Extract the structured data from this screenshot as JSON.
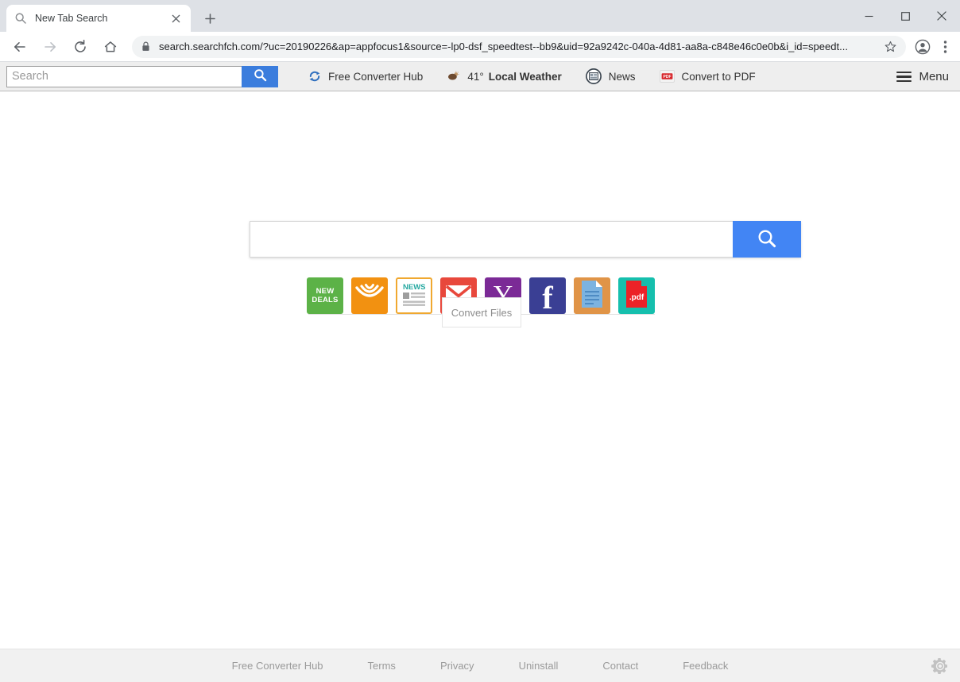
{
  "browser": {
    "tab": {
      "title": "New Tab Search",
      "favicon": "search-icon",
      "close": "×"
    },
    "new_tab_label": "+",
    "window_controls": {
      "minimize": "–",
      "maximize": "□",
      "close": "×"
    },
    "nav": {
      "back": "←",
      "forward": "→",
      "reload": "↻",
      "home": "⌂"
    },
    "omnibox": {
      "lock_icon": "lock-icon",
      "host": "search.searchfch.com",
      "path": "/?uc=20190226&ap=appfocus1&source=-lp0-dsf_speedtest--bb9&uid=92a9242c-040a-4d81-aa8a-c848e46c0e0b&i_id=speedt...",
      "full_url": "search.searchfch.com/?uc=20190226&ap=appfocus1&source=-lp0-dsf_speedtest--bb9&uid=92a9242c-040a-4d81-aa8a-c848e46c0e0b&i_id=speedt..."
    }
  },
  "ext_toolbar": {
    "search_placeholder": "Search",
    "search_value": "",
    "search_button_icon": "search-icon",
    "accent_color": "#3b7ddd",
    "links": [
      {
        "label": "Free Converter Hub",
        "icon": "convert-arrows-icon"
      },
      {
        "label": "Local Weather",
        "temp": "41°",
        "icon": "weather-icon"
      },
      {
        "label": "News",
        "icon": "newspaper-icon"
      },
      {
        "label": "Convert to PDF",
        "icon": "pdf-icon"
      }
    ],
    "menu_label": "Menu",
    "menu_icon": "hamburger-icon"
  },
  "main": {
    "search_placeholder": "",
    "search_value": "",
    "search_button_icon": "search-icon",
    "search_button_color": "#4285f4",
    "tiles": [
      {
        "name": "new-deals",
        "label": "NEW DEALS",
        "line1": "NEW",
        "line2": "DEALS",
        "color": "#5cb247"
      },
      {
        "name": "audible",
        "label": "Audible",
        "color": "#f29111"
      },
      {
        "name": "news",
        "label": "NEWS",
        "color": "#ffffff"
      },
      {
        "name": "gmail",
        "label": "Gmail",
        "color": "#e8483c"
      },
      {
        "name": "yahoo",
        "label": "Yahoo",
        "glyph": "Y",
        "color": "#7b2a96"
      },
      {
        "name": "facebook",
        "label": "Facebook",
        "glyph": "f",
        "color": "#3a3f94"
      },
      {
        "name": "document",
        "label": "Document",
        "color": "#e09447"
      },
      {
        "name": "pdf",
        "label": ".pdf",
        "color": "#16bfad"
      }
    ],
    "tooltip": "Convert Files"
  },
  "footer": {
    "links": [
      "Free Converter Hub",
      "Terms",
      "Privacy",
      "Uninstall",
      "Contact",
      "Feedback"
    ],
    "settings_icon": "gear-icon"
  }
}
